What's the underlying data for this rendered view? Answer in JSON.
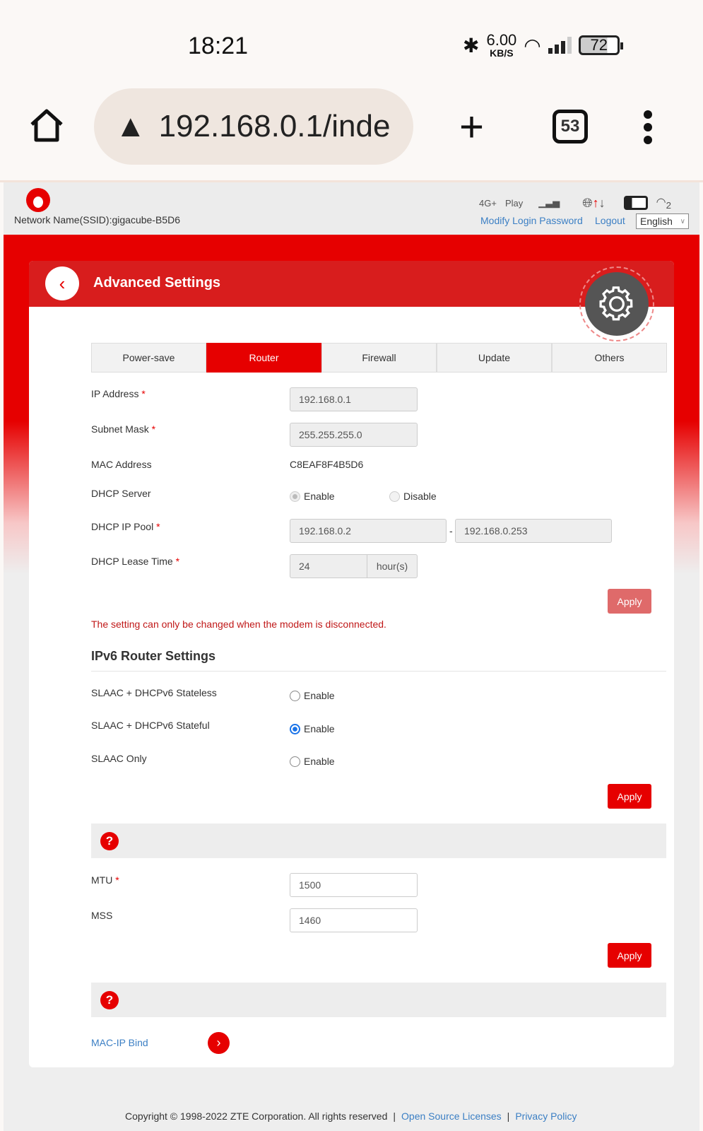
{
  "status_bar": {
    "time": "18:21",
    "speed": "6.00",
    "speed_unit": "KB/S",
    "battery": "72"
  },
  "browser": {
    "url": "192.168.0.1/inde",
    "tab_count": "53",
    "icons": [
      "home-icon",
      "warning-icon",
      "plus-icon",
      "tabs-icon",
      "more-icon"
    ]
  },
  "header": {
    "ssid": "Network Name(SSID):gigacube-B5D6",
    "network_type": "4G+",
    "operator": "Play",
    "wifi_clients": "2",
    "modify_password": "Modify Login Password",
    "logout": "Logout",
    "language": "English"
  },
  "card": {
    "title": "Advanced Settings"
  },
  "tabs": [
    {
      "label": "Power-save"
    },
    {
      "label": "Router",
      "active": true
    },
    {
      "label": "Firewall"
    },
    {
      "label": "Update"
    },
    {
      "label": "Others"
    }
  ],
  "router": {
    "ip_label": "IP Address",
    "ip": "192.168.0.1",
    "mask_label": "Subnet Mask",
    "mask": "255.255.255.0",
    "mac_label": "MAC Address",
    "mac": "C8EAF8F4B5D6",
    "dhcp_label": "DHCP Server",
    "enable": "Enable",
    "disable": "Disable",
    "pool_label": "DHCP IP Pool",
    "pool_start": "192.168.0.2",
    "pool_sep": "-",
    "pool_end": "192.168.0.253",
    "lease_label": "DHCP Lease Time",
    "lease": "24",
    "lease_unit": "hour(s)",
    "apply": "Apply",
    "note": "The setting can only be changed when the modem is disconnected."
  },
  "ipv6": {
    "title": "IPv6 Router Settings",
    "rows": [
      {
        "label": "SLAAC + DHCPv6 Stateless",
        "option": "Enable",
        "checked": false
      },
      {
        "label": "SLAAC + DHCPv6 Stateful",
        "option": "Enable",
        "checked": true
      },
      {
        "label": "SLAAC Only",
        "option": "Enable",
        "checked": false
      }
    ],
    "apply": "Apply"
  },
  "mtu": {
    "q": "?",
    "mtu_label": "MTU",
    "mtu": "1500",
    "mss_label": "MSS",
    "mss": "1460",
    "apply": "Apply"
  },
  "macip": {
    "q": "?",
    "label": "MAC-IP Bind"
  },
  "footer": {
    "copyright": "Copyright © 1998-2022 ZTE Corporation. All rights reserved",
    "sep": "|",
    "oss": "Open Source Licenses",
    "privacy": "Privacy Policy"
  },
  "colors": {
    "brand": "#e60000",
    "link": "#3b7fc4",
    "radio_selected": "#1a73e8"
  }
}
